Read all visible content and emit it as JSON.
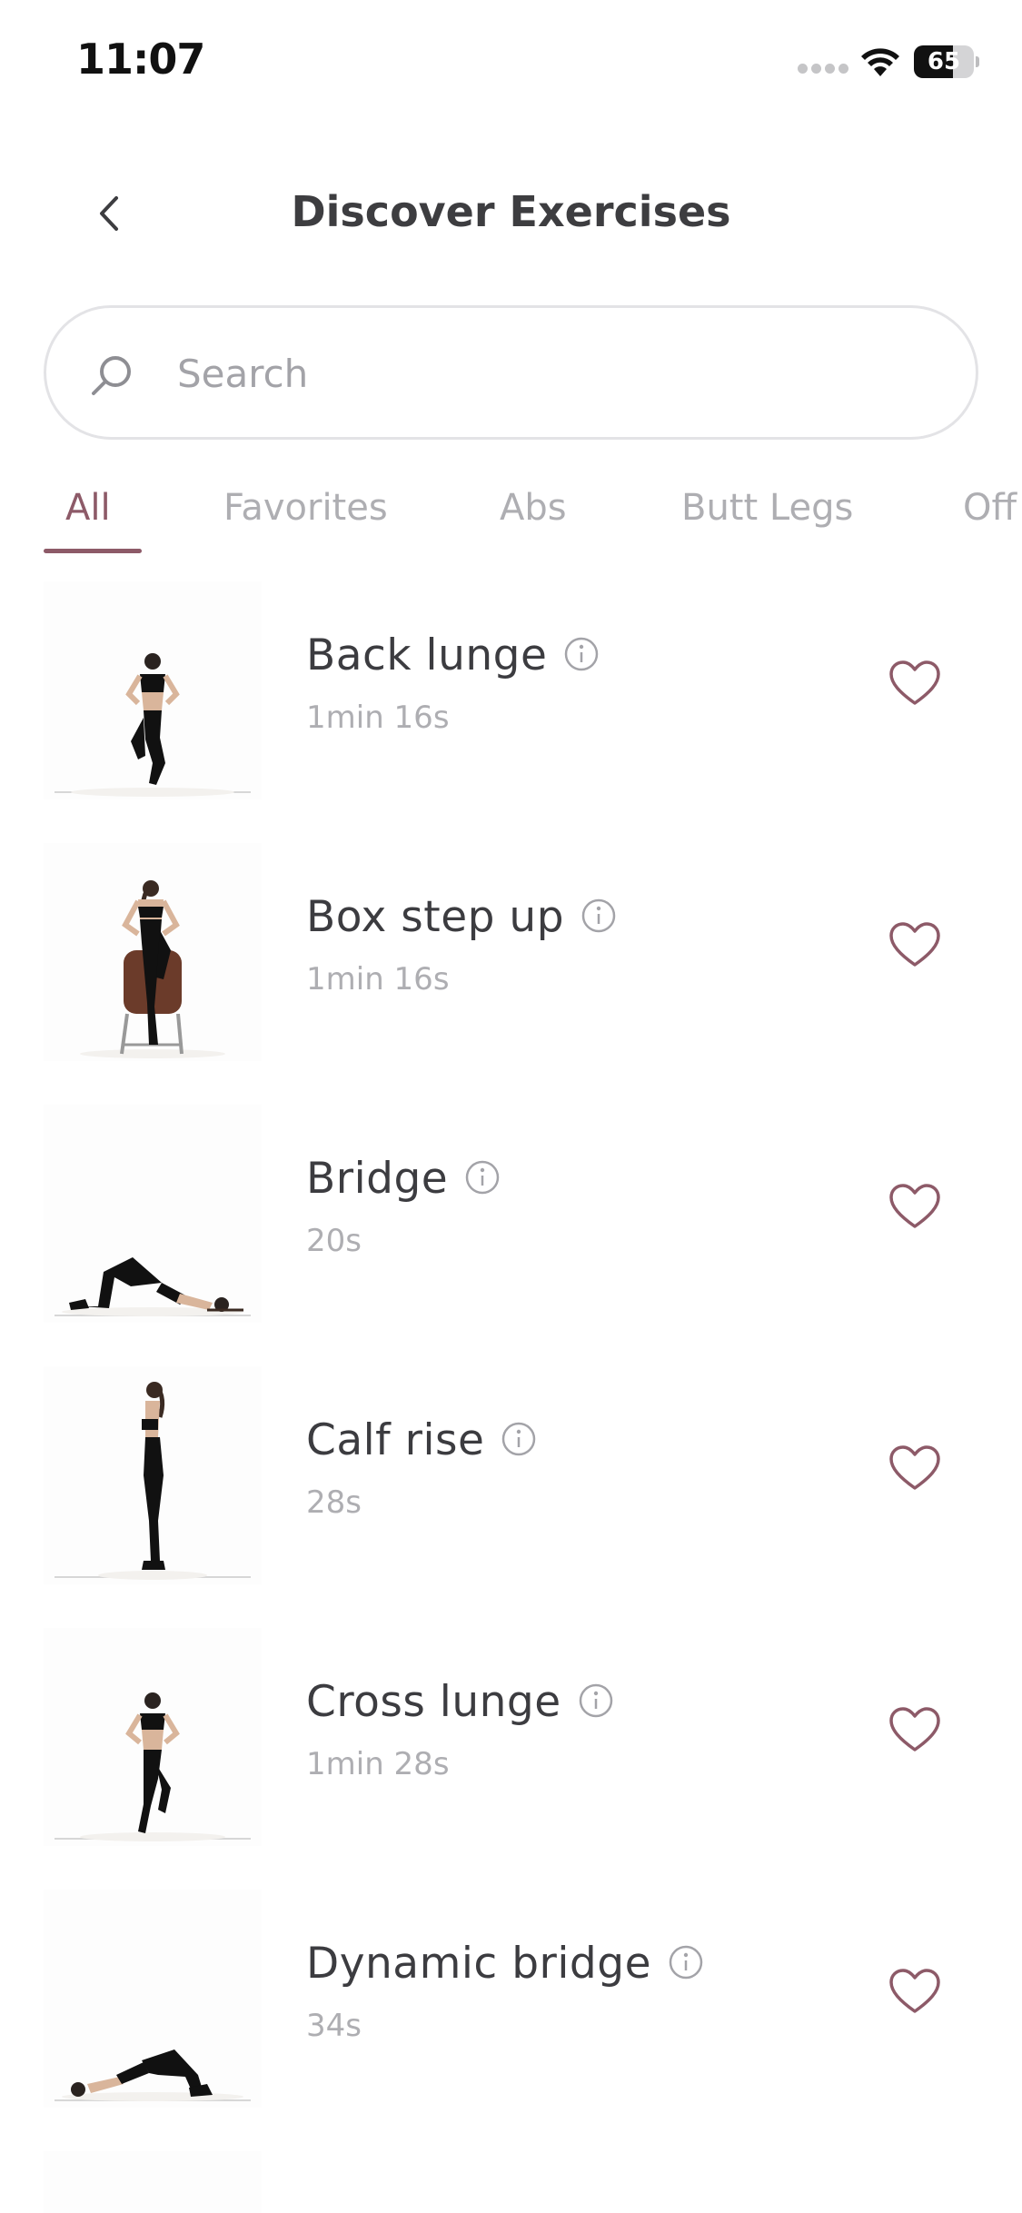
{
  "status_bar": {
    "time": "11:07",
    "battery": "65",
    "battery_level": 0.65
  },
  "header": {
    "title": "Discover Exercises"
  },
  "search": {
    "placeholder": "Search"
  },
  "tabs": [
    {
      "label": "All",
      "active": true
    },
    {
      "label": "Favorites",
      "active": false
    },
    {
      "label": "Abs",
      "active": false
    },
    {
      "label": "Butt Legs",
      "active": false
    },
    {
      "label": "Off",
      "active": false
    }
  ],
  "exercises": [
    {
      "name": "Back lunge",
      "duration": "1min 16s",
      "favorite": false
    },
    {
      "name": "Box step up",
      "duration": "1min 16s",
      "favorite": false
    },
    {
      "name": "Bridge",
      "duration": "20s",
      "favorite": false
    },
    {
      "name": "Calf rise",
      "duration": "28s",
      "favorite": false
    },
    {
      "name": "Cross lunge",
      "duration": "1min 28s",
      "favorite": false
    },
    {
      "name": "Dynamic bridge",
      "duration": "34s",
      "favorite": false
    }
  ],
  "colors": {
    "accent": "#8d5a68",
    "muted_text": "#aeaeb2",
    "title_text": "#3d3d40",
    "border": "#e3e3e6"
  }
}
